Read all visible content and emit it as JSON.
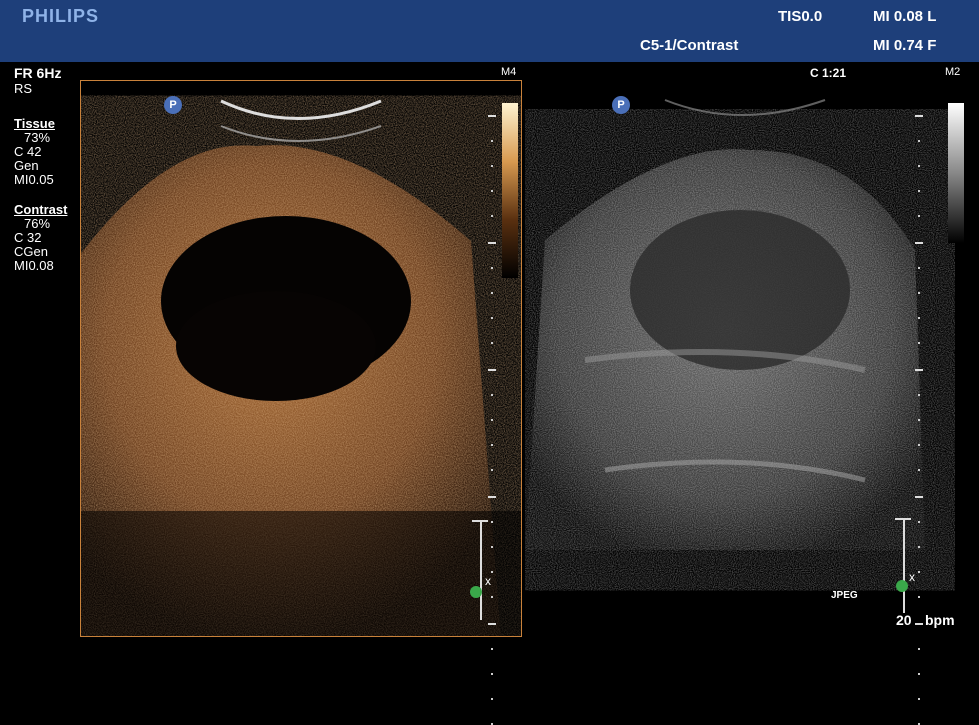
{
  "header": {
    "brand": "PHILIPS",
    "tis": "TIS0.0",
    "mi_left": "MI 0.08 L",
    "probe_mode": "C5-1/Contrast",
    "mi_right": "MI 0.74 F"
  },
  "left_info": {
    "frame_rate": "FR 6Hz",
    "rs": "RS",
    "tissue": {
      "label": "Tissue",
      "gain": "73%",
      "compression": "C 42",
      "mode": "Gen",
      "mi": "MI0.05"
    },
    "contrast": {
      "label": "Contrast",
      "gain": "76%",
      "compression": "C 32",
      "mode": "CGen",
      "mi": "MI0.08"
    }
  },
  "left_pane": {
    "map_label": "M4",
    "marker": "P",
    "caliper_label": "x"
  },
  "right_pane": {
    "timer": "C 1:21",
    "map_label": "M2",
    "marker": "P",
    "caliper_label": "x"
  },
  "footer": {
    "jpeg": "JPEG",
    "heart_rate": "20",
    "bpm_unit": "bpm"
  },
  "colors": {
    "header_bg": "#1e3f7a",
    "contrast_border": "#c9823b",
    "brand": "#8fb3e8"
  }
}
